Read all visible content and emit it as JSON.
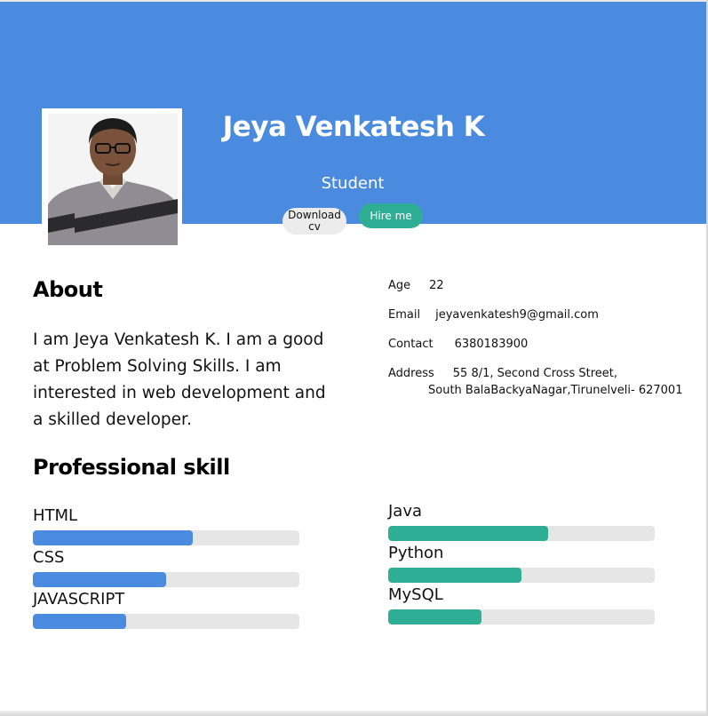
{
  "profile": {
    "name": "Jeya Venkatesh K",
    "role": "Student",
    "download_label": "Download cv",
    "hire_label": "Hire me"
  },
  "about": {
    "heading": "About",
    "text": "I am Jeya Venkatesh K. I am a good at Problem Solving Skills. I am interested in web development and a skilled developer."
  },
  "info": {
    "age_label": "Age",
    "age_value": "22",
    "email_label": "Email",
    "email_value": "jeyavenkatesh9@gmail.com",
    "contact_label": "Contact",
    "contact_value": "6380183900",
    "address_label": "Address",
    "address_line1": "55 8/1, Second Cross Street,",
    "address_line2": "South BalaBackyaNagar,Tirunelveli- 627001"
  },
  "skills": {
    "heading": "Professional skill",
    "left": [
      {
        "name": "HTML",
        "level": 0.6
      },
      {
        "name": "CSS",
        "level": 0.5
      },
      {
        "name": "JAVASCRIPT",
        "level": 0.35
      }
    ],
    "right": [
      {
        "name": "Java",
        "level": 0.6
      },
      {
        "name": "Python",
        "level": 0.5
      },
      {
        "name": "MySQL",
        "level": 0.35
      }
    ]
  },
  "colors": {
    "header": "#4a8be0",
    "accent_blue": "#4a8be0",
    "accent_green": "#2eaf95"
  }
}
